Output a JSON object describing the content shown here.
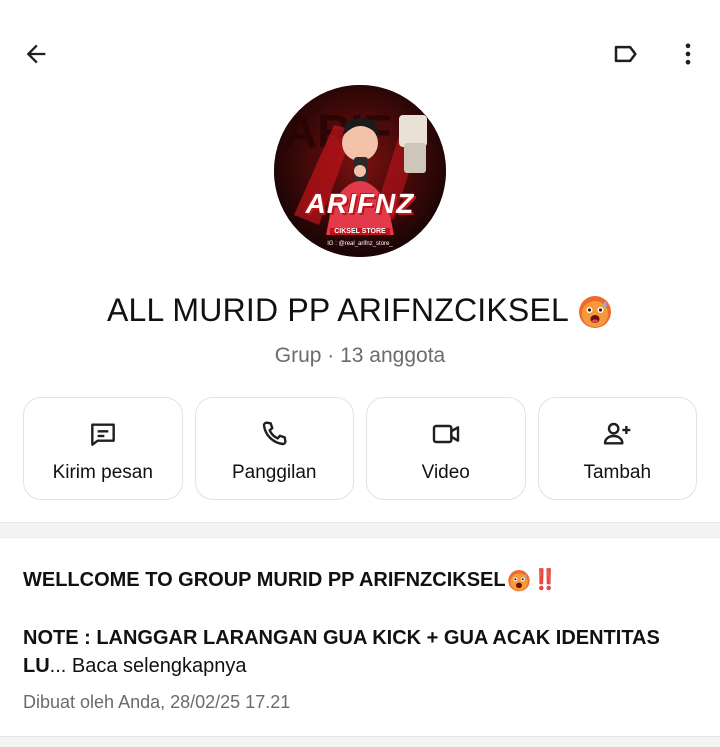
{
  "header": {
    "back_icon": "arrow-left-icon",
    "label_icon": "label-tag-icon",
    "more_icon": "more-vertical-icon"
  },
  "avatar": {
    "logo_text": "ARIFNZ",
    "store_text": "CIKSEL STORE",
    "ig_text": "IG : @real_arifnz_store_",
    "colors": {
      "bg": "#1a0606",
      "accent": "#d11a1a"
    }
  },
  "group": {
    "name": "ALL MURID PP ARIFNZCIKSEL",
    "name_emoji": "hot-face-emoji",
    "subtitle": "Grup · 13 anggota"
  },
  "actions": [
    {
      "label": "Kirim pesan",
      "icon": "message-icon"
    },
    {
      "label": "Panggilan",
      "icon": "phone-icon"
    },
    {
      "label": "Video",
      "icon": "video-icon"
    },
    {
      "label": "Tambah",
      "icon": "add-person-icon"
    }
  ],
  "description": {
    "line1": "WELLCOME TO GROUP MURID PP ARIFNZCIKSEL",
    "line1_suffix": "‼️",
    "line2": "NOTE : LANGGAR LARANGAN GUA KICK + GUA ACAK IDENTITAS",
    "line3": "LU",
    "ellipsis": "...",
    "read_more": " Baca selengkapnya",
    "meta": "Dibuat oleh Anda, 28/02/25 17.21"
  }
}
